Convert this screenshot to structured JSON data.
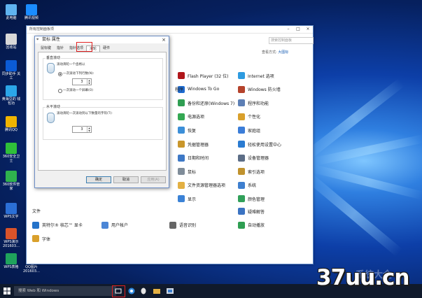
{
  "desktop": {
    "icons": [
      {
        "label": "此电脑",
        "color": "#5fb3f0"
      },
      {
        "label": "腾讯视频",
        "color": "#1a8cff"
      },
      {
        "label": "回收站",
        "color": "#d8d8d8"
      },
      {
        "label": "同步助手 关工",
        "color": "#0b5bd6"
      },
      {
        "label": "黄海豆的 钱包功",
        "color": "#2ba6e8"
      },
      {
        "label": "腾讯QQ",
        "color": "#f0b400"
      },
      {
        "label": "360安全卫士",
        "color": "#2fbf3a"
      },
      {
        "label": "360软件管家",
        "color": "#2fb24e"
      },
      {
        "label": "WPS文字",
        "color": "#2b6fd6"
      },
      {
        "label": "WPS演示 201603…",
        "color": "#d9532a"
      },
      {
        "label": "WPS表格",
        "color": "#1fa35c"
      },
      {
        "label": "QQ图片 201603…",
        "color": "#999999"
      }
    ]
  },
  "control_panel": {
    "title": "所有控制面板项",
    "search_placeholder": "搜索控制面板",
    "view_label": "查看方式:",
    "view_value": "大图标",
    "items": [
      {
        "label": "Flash Player (32 位)",
        "icon": "flash-icon",
        "color": "#b0161a"
      },
      {
        "label": "Internet 选项",
        "icon": "globe-icon",
        "color": "#2e9be0"
      },
      {
        "label": "Windows To Go",
        "icon": "usb-icon",
        "color": "#1e6bd0"
      },
      {
        "label": "Windows 防火墙",
        "icon": "firewall-icon",
        "color": "#b5432c"
      },
      {
        "label": "备份和还原(Windows 7)",
        "icon": "backup-icon",
        "color": "#2f9e52"
      },
      {
        "label": "程序和功能",
        "icon": "programs-icon",
        "color": "#5d7fb5"
      },
      {
        "label": "电源选项",
        "icon": "power-icon",
        "color": "#34a853"
      },
      {
        "label": "个性化",
        "icon": "personalize-icon",
        "color": "#d9a02c"
      },
      {
        "label": "恢复",
        "icon": "recovery-icon",
        "color": "#3c8fd8"
      },
      {
        "label": "家庭组",
        "icon": "homegroup-icon",
        "color": "#3b7dd8"
      },
      {
        "label": "凭据管理器",
        "icon": "credential-icon",
        "color": "#c9962b"
      },
      {
        "label": "轻松使用设置中心",
        "icon": "ease-icon",
        "color": "#2a7bd1"
      },
      {
        "label": "日期和时间",
        "icon": "clock-icon",
        "color": "#3d78c6"
      },
      {
        "label": "设备管理器",
        "icon": "device-icon",
        "color": "#5c6d86"
      },
      {
        "label": "鼠标",
        "icon": "mouse-icon",
        "color": "#7f8c99"
      },
      {
        "label": "索引选项",
        "icon": "index-icon",
        "color": "#c0922e"
      },
      {
        "label": "文件资源管理器选项",
        "icon": "folder-icon",
        "color": "#e3b043"
      },
      {
        "label": "系统",
        "icon": "system-icon",
        "color": "#3e7fcf"
      },
      {
        "label": "显示",
        "icon": "display-icon",
        "color": "#3b82d6"
      },
      {
        "label": "颜色管理",
        "icon": "color-icon",
        "color": "#31a05a"
      },
      {
        "label": "疑难解答",
        "icon": "trouble-icon",
        "color": "#3b73c2"
      },
      {
        "label": "英特尔® 核芯™ 显卡",
        "icon": "intel-icon",
        "color": "#2573c9"
      },
      {
        "label": "用户帐户",
        "icon": "user-icon",
        "color": "#4b86d6"
      },
      {
        "label": "语音识别",
        "icon": "speech-icon",
        "color": "#666666"
      },
      {
        "label": "自动播放",
        "icon": "autoplay-icon",
        "color": "#2f9e52"
      },
      {
        "label": "字体",
        "icon": "font-icon",
        "color": "#d9a02c"
      }
    ],
    "partial_items": [
      "程序",
      "文件"
    ]
  },
  "mouse_dialog": {
    "title": "鼠标 属性",
    "tabs": [
      "鼠标键",
      "指针",
      "指针选项",
      "滑轮",
      "硬件"
    ],
    "active_tab": "滑轮",
    "vertical_group": "垂直滚动",
    "vertical_desc": "滚动滑轮一个齿格以",
    "radio_lines": "一次滚动下列行数(N):",
    "lines_value": "3",
    "radio_screen": "一次滚动一个屏幕(O)",
    "horizontal_group": "水平滚动",
    "horizontal_desc": "滚动滑轮一次滚动到以下数量的字符(T):",
    "chars_value": "3",
    "ok": "确定",
    "cancel": "取消",
    "apply": "应用(A)"
  },
  "taskbar": {
    "search_placeholder": "搜索 Web 和 Windows"
  },
  "watermark": "37uu.cn",
  "watermark_ghost": "系统大全"
}
